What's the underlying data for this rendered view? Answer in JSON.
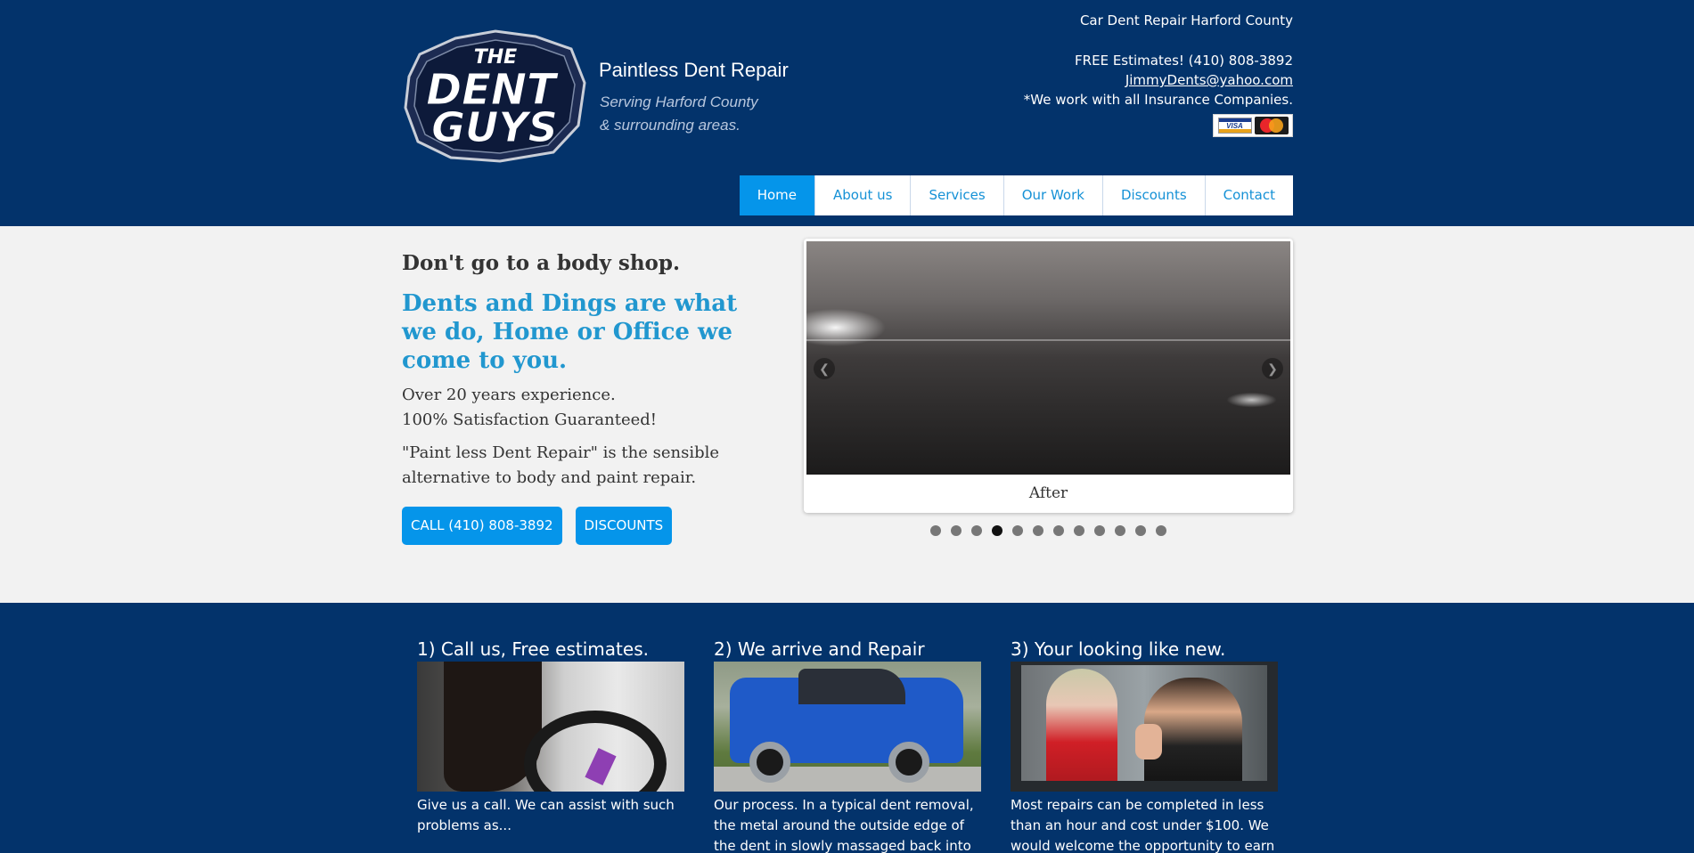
{
  "header": {
    "logo_text": "THE DENT GUYS",
    "tagline_title": "Paintless Dent Repair",
    "tagline_sub_1": "Serving Harford County",
    "tagline_sub_2": "& surrounding areas.",
    "contact": {
      "site_heading": "Car Dent Repair Harford County",
      "estimates": "FREE Estimates! (410) 808-3892",
      "email": "JimmyDents@yahoo.com",
      "insurance": "*We work with all Insurance Companies."
    },
    "cards": [
      "VISA",
      "MasterCard"
    ]
  },
  "nav": {
    "items": [
      "Home",
      "About us",
      "Services",
      "Our Work",
      "Discounts",
      "Contact"
    ],
    "active": "Home"
  },
  "hero": {
    "heading": "Don't go to a body shop.",
    "subheading": "Dents and Dings are what we do, Home or Office we come to you.",
    "line1": "Over 20 years experience.",
    "line2": "100% Satisfaction Guaranteed!",
    "paragraph": "\"Paint less Dent Repair\" is the sensible alternative to body and paint repair.",
    "buttons": {
      "call": "CALL (410) 808-3892",
      "discounts": "DISCOUNTS"
    }
  },
  "slider": {
    "caption": "After",
    "dot_count": 12,
    "active_dot": 4,
    "prev_icon": "chevron-left-icon",
    "next_icon": "chevron-right-icon"
  },
  "steps": [
    {
      "title": "1) Call us, Free estimates.",
      "text": "Give us a call. We can assist with such problems as..."
    },
    {
      "title": "2) We arrive and Repair",
      "text": "Our process. In a typical dent removal, the metal around the outside edge of the dent in slowly massaged back into its"
    },
    {
      "title": "3) Your looking like new.",
      "text": "Most repairs can be completed in less than an hour and cost under $100. We would welcome the opportunity to earn"
    }
  ],
  "colors": {
    "header_bg": "#03336b",
    "accent": "#0595ea",
    "subheading": "#2197cf",
    "page_bg": "#f2f2f2"
  }
}
